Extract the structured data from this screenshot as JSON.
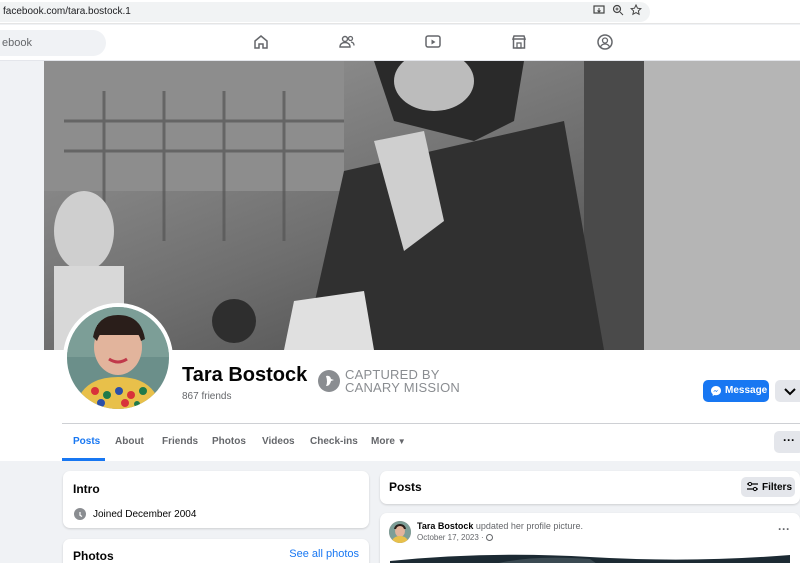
{
  "browser": {
    "url": "facebook.com/tara.bostock.1"
  },
  "nav": {
    "search_placeholder": "ebook",
    "icons": [
      "home-icon",
      "friends-icon",
      "video-icon",
      "marketplace-icon",
      "profile-icon"
    ]
  },
  "profile": {
    "name": "Tara Bostock",
    "friends": "867 friends",
    "stamp_line1": "CAPTURED BY",
    "stamp_line2": "CANARY MISSION",
    "message_label": "Message"
  },
  "tabs": [
    {
      "label": "Posts",
      "active": true
    },
    {
      "label": "About"
    },
    {
      "label": "Friends"
    },
    {
      "label": "Photos"
    },
    {
      "label": "Videos"
    },
    {
      "label": "Check-ins"
    },
    {
      "label": "More"
    }
  ],
  "intro": {
    "title": "Intro",
    "joined": "Joined December 2004"
  },
  "photos": {
    "title": "Photos",
    "see_all": "See all photos"
  },
  "posts": {
    "title": "Posts",
    "filters_label": "Filters",
    "items": [
      {
        "author": "Tara Bostock",
        "action": "updated her profile picture.",
        "date": "October 17, 2023 · "
      }
    ]
  },
  "colors": {
    "accent": "#1877f2",
    "background": "#f0f2f5"
  }
}
